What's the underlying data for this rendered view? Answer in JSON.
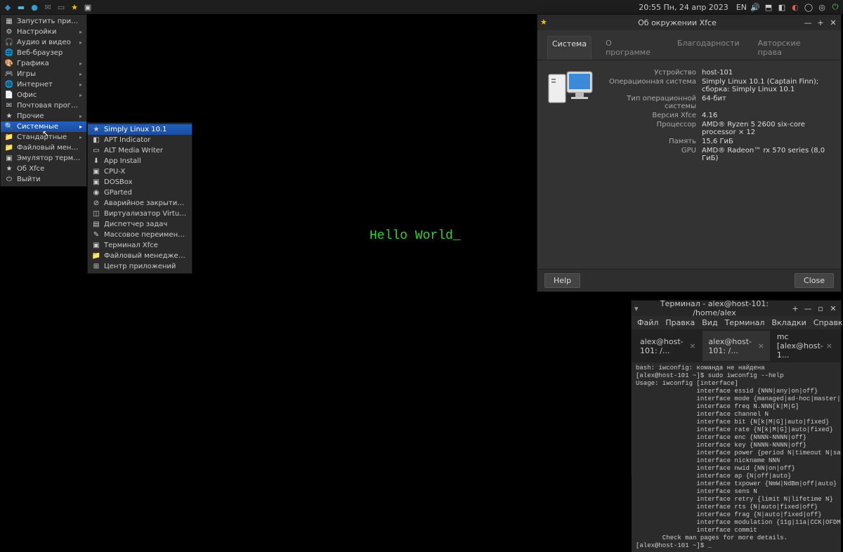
{
  "panel": {
    "clock": "20:55  Пн, 24 апр 2023",
    "lang": "EN"
  },
  "menu": [
    {
      "icon": "▦",
      "label": "Запустить приложение...",
      "arrow": false
    },
    {
      "icon": "⚙",
      "label": "Настройки",
      "arrow": true
    },
    {
      "icon": "🎧",
      "label": "Аудио и видео",
      "arrow": true
    },
    {
      "icon": "🌐",
      "label": "Веб-браузер",
      "arrow": false
    },
    {
      "icon": "🎨",
      "label": "Графика",
      "arrow": true
    },
    {
      "icon": "🎮",
      "label": "Игры",
      "arrow": true
    },
    {
      "icon": "🌐",
      "label": "Интернет",
      "arrow": true
    },
    {
      "icon": "📄",
      "label": "Офис",
      "arrow": true
    },
    {
      "icon": "✉",
      "label": "Почтовая программа",
      "arrow": false
    },
    {
      "icon": "★",
      "label": "Прочие",
      "arrow": true
    },
    {
      "icon": "🔍",
      "label": "Системные",
      "arrow": true,
      "sel": true
    },
    {
      "icon": "📁",
      "label": "Стандартные",
      "arrow": true
    },
    {
      "icon": "📁",
      "label": "Файловый менеджер",
      "arrow": false
    },
    {
      "icon": "▣",
      "label": "Эмулятор терминала",
      "arrow": false
    },
    {
      "icon": "★",
      "label": "Об Xfce",
      "arrow": false
    },
    {
      "icon": "⏻",
      "label": "Выйти",
      "arrow": false
    }
  ],
  "submenu": [
    {
      "icon": "★",
      "label": "Simply Linux 10.1",
      "sel": true
    },
    {
      "icon": "◧",
      "label": "APT Indicator"
    },
    {
      "icon": "▭",
      "label": "ALT Media Writer"
    },
    {
      "icon": "⬇",
      "label": "App Install"
    },
    {
      "icon": "▣",
      "label": "CPU-X"
    },
    {
      "icon": "▣",
      "label": "DOSBox"
    },
    {
      "icon": "◉",
      "label": "GParted"
    },
    {
      "icon": "⊘",
      "label": "Аварийное закрытие программы"
    },
    {
      "icon": "◫",
      "label": "Виртуализатор VirtualBox"
    },
    {
      "icon": "▤",
      "label": "Диспетчер задач"
    },
    {
      "icon": "✎",
      "label": "Массовое переименование"
    },
    {
      "icon": "▣",
      "label": "Терминал Xfce"
    },
    {
      "icon": "📁",
      "label": "Файловый менеджер Thunar"
    },
    {
      "icon": "⊞",
      "label": "Центр приложений"
    }
  ],
  "hello": "Hello World_",
  "about": {
    "title": "Об окружении Xfce",
    "tabs": [
      "Система",
      "О программе",
      "Благодарности",
      "Авторские права"
    ],
    "rows": [
      {
        "label": "Устройство",
        "value": "host-101"
      },
      {
        "label": "Операционная система",
        "value": "Simply Linux 10.1 (Captain Finn); сборка: Simply Linux 10.1"
      },
      {
        "label": "Тип операционной системы",
        "value": "64-бит"
      },
      {
        "label": "Версия Xfce",
        "value": "4.16"
      },
      {
        "label": "Процессор",
        "value": "AMD® Ryzen 5 2600 six-core processor × 12"
      },
      {
        "label": "Память",
        "value": "15,6 ГиБ"
      },
      {
        "label": "GPU",
        "value": "AMD® Radeon™ rx 570 series (8,0 ГиБ)"
      }
    ],
    "help": "Help",
    "close": "Close"
  },
  "term": {
    "title": "Терминал - alex@host-101: /home/alex",
    "menus": [
      "Файл",
      "Правка",
      "Вид",
      "Терминал",
      "Вкладки",
      "Справка"
    ],
    "tabs": [
      "alex@host-101: /...",
      "alex@host-101: /...",
      "mc [alex@host-1..."
    ],
    "body": "bash: iwconfig: команда не найдена\n[alex@host-101 ~]$ sudo iwconfig --help\nUsage: iwconfig [interface]\n                interface essid {NNN|any|on|off}\n                interface mode {managed|ad-hoc|master|...}\n                interface freq N.NNN[k|M|G]\n                interface channel N\n                interface bit {N[k|M|G]|auto|fixed}\n                interface rate {N[k|M|G]|auto|fixed}\n                interface enc {NNNN-NNNN|off}\n                interface key {NNNN-NNNN|off}\n                interface power {period N|timeout N|saving N|off}\n                interface nickname NNN\n                interface nwid {NN|on|off}\n                interface ap {N|off|auto}\n                interface txpower {NmW|NdBm|off|auto}\n                interface sens N\n                interface retry {limit N|lifetime N}\n                interface rts {N|auto|fixed|off}\n                interface frag {N|auto|fixed|off}\n                interface modulation {11g|11a|CCK|OFDMg|...}\n                interface commit\n       Check man pages for more details.\n[alex@host-101 ~]$ _"
  }
}
